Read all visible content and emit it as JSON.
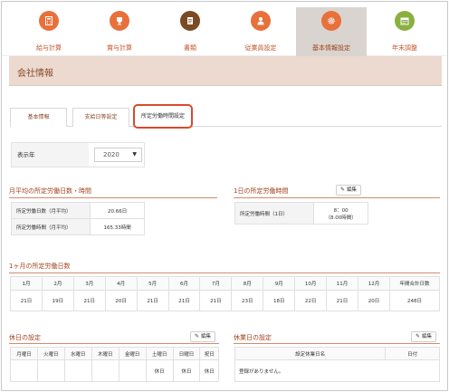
{
  "nav": {
    "items": [
      {
        "label": "給与計算",
        "icon": "calculator-icon",
        "color": "#e8703a"
      },
      {
        "label": "賞与計算",
        "icon": "trophy-icon",
        "color": "#e8703a"
      },
      {
        "label": "書類",
        "icon": "document-icon",
        "color": "#7a4a24"
      },
      {
        "label": "従業員設定",
        "icon": "person-icon",
        "color": "#e8703a"
      },
      {
        "label": "基本情報設定",
        "icon": "gear-icon",
        "color": "#e8703a"
      },
      {
        "label": "年末調整",
        "icon": "calendar-icon",
        "color": "#8ab040"
      }
    ]
  },
  "page": {
    "title": "会社情報"
  },
  "tabs": [
    "基本情報",
    "支給日等設定",
    "所定労働時間設定"
  ],
  "year": {
    "label": "表示年",
    "value": "2020"
  },
  "monthly_avg": {
    "title": "月平均の所定労働日数・時間",
    "rows": [
      {
        "label": "所定労働日数（月平均）",
        "value": "20.66日"
      },
      {
        "label": "所定労働時間（月平均）",
        "value": "165.33時間"
      }
    ]
  },
  "daily": {
    "title": "1日の所定労働時間",
    "edit": "編集",
    "label": "所定労働時間（1日）",
    "value_line1": "8：00",
    "value_line2": "（8.00時間）"
  },
  "month_days": {
    "title": "1ヶ月の所定労働日数",
    "headers": [
      "1月",
      "2月",
      "3月",
      "4月",
      "5月",
      "6月",
      "7月",
      "8月",
      "9月",
      "10月",
      "11月",
      "12月",
      "年間合計日数"
    ],
    "values": [
      "21日",
      "19日",
      "21日",
      "20日",
      "21日",
      "21日",
      "21日",
      "23日",
      "18日",
      "22日",
      "21日",
      "20日",
      "248日"
    ]
  },
  "holidays": {
    "title": "休日の設定",
    "edit": "編集",
    "headers": [
      "月曜日",
      "火曜日",
      "水曜日",
      "木曜日",
      "金曜日",
      "土曜日",
      "日曜日",
      "祝日"
    ],
    "values": [
      "",
      "",
      "",
      "",
      "",
      "休日",
      "休日",
      "休日"
    ]
  },
  "special": {
    "title": "休業日の設定",
    "edit": "編集",
    "headers": [
      "設定休業日名",
      "日付"
    ],
    "empty": "登録がありません。"
  }
}
